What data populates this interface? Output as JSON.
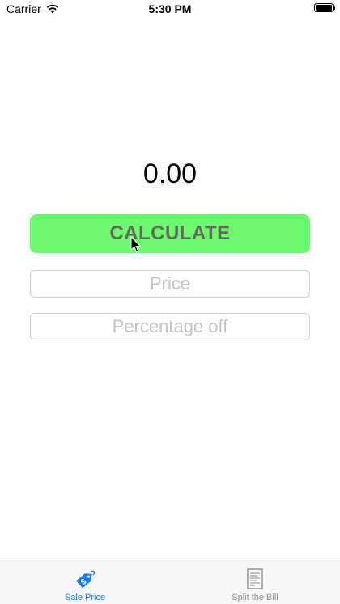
{
  "status_bar": {
    "carrier": "Carrier",
    "time": "5:30 PM"
  },
  "result": {
    "value": "0.00"
  },
  "calculate_button": {
    "label": "CALCULATE",
    "color": "#6df96d"
  },
  "inputs": {
    "price": {
      "value": "",
      "placeholder": "Price"
    },
    "percentage": {
      "value": "",
      "placeholder": "Percentage off"
    }
  },
  "tabs": [
    {
      "label": "Sale Price",
      "icon": "price-tag-icon",
      "active": true
    },
    {
      "label": "Split the Bill",
      "icon": "receipt-icon",
      "active": false
    }
  ],
  "colors": {
    "accent": "#1a7cf5",
    "inactive": "#8e8e93"
  }
}
